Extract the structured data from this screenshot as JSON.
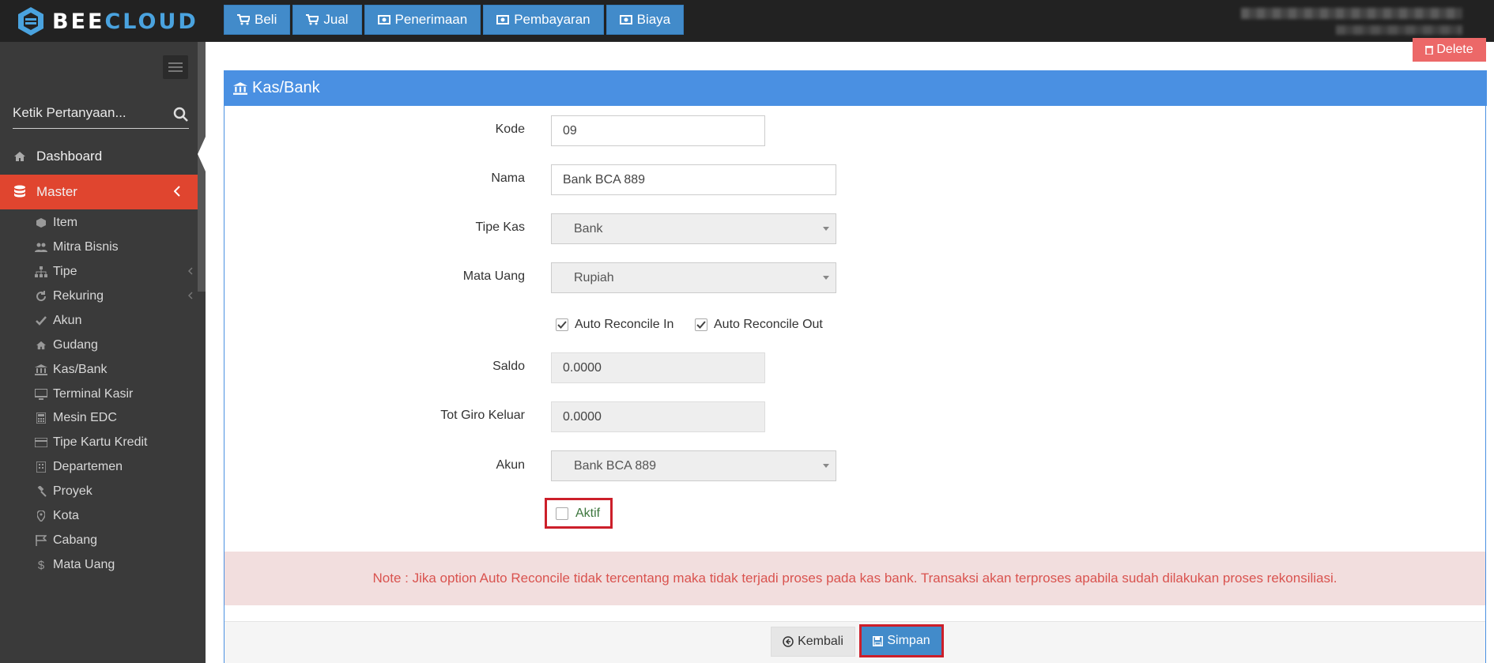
{
  "app": {
    "logo_bee": "BEE",
    "logo_cloud": "CLOUD"
  },
  "topnav": [
    {
      "label": "Beli",
      "icon": "cart-icon"
    },
    {
      "label": "Jual",
      "icon": "cart-icon"
    },
    {
      "label": "Penerimaan",
      "icon": "money-icon"
    },
    {
      "label": "Pembayaran",
      "icon": "money-icon"
    },
    {
      "label": "Biaya",
      "icon": "money-icon"
    }
  ],
  "sidebar": {
    "search_placeholder": "Ketik Pertanyaan...",
    "dashboard": "Dashboard",
    "master": "Master",
    "items": [
      {
        "label": "Item",
        "icon": "cube-icon"
      },
      {
        "label": "Mitra Bisnis",
        "icon": "users-icon"
      },
      {
        "label": "Tipe",
        "icon": "sitemap-icon"
      },
      {
        "label": "Rekuring",
        "icon": "refresh-icon"
      },
      {
        "label": "Akun",
        "icon": "check-icon"
      },
      {
        "label": "Gudang",
        "icon": "home-icon"
      },
      {
        "label": "Kas/Bank",
        "icon": "bank-icon"
      },
      {
        "label": "Terminal Kasir",
        "icon": "desktop-icon"
      },
      {
        "label": "Mesin EDC",
        "icon": "calculator-icon"
      },
      {
        "label": "Tipe Kartu Kredit",
        "icon": "credit-card-icon"
      },
      {
        "label": "Departemen",
        "icon": "building-icon"
      },
      {
        "label": "Proyek",
        "icon": "gavel-icon"
      },
      {
        "label": "Kota",
        "icon": "map-marker-icon"
      },
      {
        "label": "Cabang",
        "icon": "flag-icon"
      },
      {
        "label": "Mata Uang",
        "icon": "dollar-icon"
      }
    ]
  },
  "actions": {
    "delete": "Delete",
    "kembali": "Kembali",
    "simpan": "Simpan"
  },
  "panel": {
    "title": "Kas/Bank"
  },
  "form": {
    "kode_label": "Kode",
    "kode_value": "09",
    "nama_label": "Nama",
    "nama_value": "Bank BCA 889",
    "tipe_kas_label": "Tipe Kas",
    "tipe_kas_value": "Bank",
    "mata_uang_label": "Mata Uang",
    "mata_uang_value": "Rupiah",
    "auto_in_label": "Auto Reconcile In",
    "auto_in_checked": true,
    "auto_out_label": "Auto Reconcile Out",
    "auto_out_checked": true,
    "saldo_label": "Saldo",
    "saldo_value": "0.0000",
    "tot_giro_label": "Tot Giro Keluar",
    "tot_giro_value": "0.0000",
    "akun_label": "Akun",
    "akun_value": "Bank BCA 889",
    "aktif_label": "Aktif",
    "aktif_checked": false
  },
  "note": "Note : Jika option Auto Reconcile tidak tercentang maka tidak terjadi proses pada kas bank. Transaksi akan terproses apabila sudah dilakukan proses rekonsiliasi.",
  "colors": {
    "topbar": "#222222",
    "sidebar": "#3a3a3a",
    "active": "#e0452f",
    "primary": "#428bca",
    "panel_head": "#4a90e2",
    "delete": "#ec6868",
    "highlight": "#cc1f2a"
  }
}
